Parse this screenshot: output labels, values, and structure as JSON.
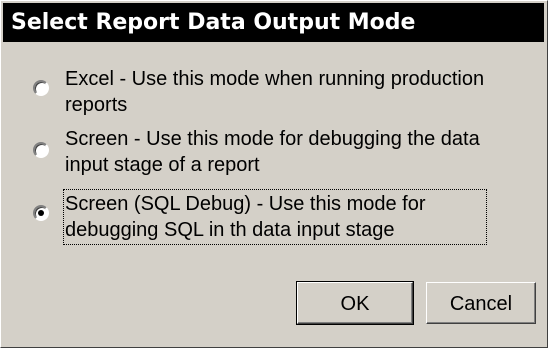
{
  "dialog": {
    "title": "Select Report Data Output Mode",
    "options": [
      {
        "line1": "Excel - Use this mode when running production",
        "line2": "reports",
        "checked": false
      },
      {
        "line1": "Screen - Use this mode for debugging the data",
        "line2": "input stage of a report",
        "checked": false
      },
      {
        "line1": "Screen (SQL Debug) - Use this mode for",
        "line2": "debugging SQL in th data input stage",
        "checked": true
      }
    ],
    "ok_label": "OK",
    "cancel_label": "Cancel"
  },
  "colors": {
    "face": "#d4d0c8",
    "titlebar": "#000000",
    "title_text": "#ffffff"
  }
}
